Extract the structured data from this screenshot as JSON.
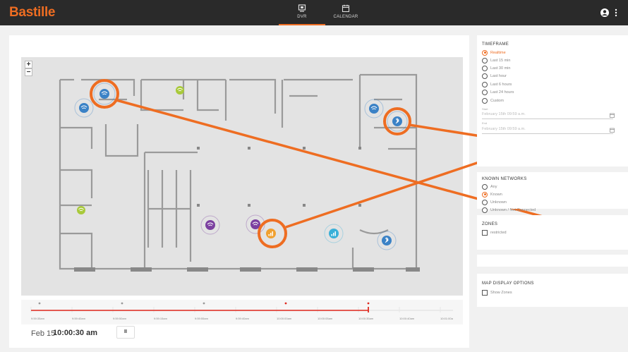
{
  "header": {
    "brand": "Bastille",
    "tabs": [
      {
        "label": "DVR",
        "icon": "dvr-icon",
        "active": true
      },
      {
        "label": "CALENDAR",
        "icon": "calendar-icon",
        "active": false
      }
    ],
    "user_icon": "user-icon",
    "menu_icon": "more-vertical-icon"
  },
  "map": {
    "zoom_in": "+",
    "zoom_out": "−",
    "devices": [
      {
        "type": "wifi",
        "color": "#3b82c6",
        "highlighted": true
      },
      {
        "type": "wifi",
        "color": "#3b82c6",
        "highlighted": false
      },
      {
        "type": "wifi",
        "color": "#a8c93a",
        "highlighted": false
      },
      {
        "type": "wifi",
        "color": "#3b82c6",
        "highlighted": false
      },
      {
        "type": "bluetooth",
        "color": "#3b82c6",
        "highlighted": true
      },
      {
        "type": "wifi",
        "color": "#a8c93a",
        "highlighted": false
      },
      {
        "type": "wifi",
        "color": "#7b3fa0",
        "highlighted": false
      },
      {
        "type": "wifi",
        "color": "#7b3fa0",
        "highlighted": false
      },
      {
        "type": "cellular",
        "color": "#f0a030",
        "highlighted": true
      },
      {
        "type": "cellular",
        "color": "#3ab0d8",
        "highlighted": false
      },
      {
        "type": "bluetooth",
        "color": "#3b82c6",
        "highlighted": false
      }
    ]
  },
  "timeline": {
    "ticks": [
      "9:59:35am",
      "9:59:40am",
      "9:59:50am",
      "9:59:15am",
      "9:59:55am",
      "9:59:40am",
      "10:00:00am",
      "10:00:05am",
      "10:00:35am",
      "10:00:40am",
      "10:01:00a"
    ],
    "progress": 0.86,
    "date": "Feb 15",
    "time": "10:00:30 am",
    "pause_label": "II"
  },
  "timeframe": {
    "title": "TIMEFRAME",
    "options": [
      "Realtime",
      "Last 15 min",
      "Last 30 min",
      "Last hour",
      "Last 6 hours",
      "Last 24 hours",
      "Custom"
    ],
    "selected": "Realtime",
    "start_caption": "Start",
    "start_value": "February 15th 09:59 a.m.",
    "end_caption": "End",
    "end_value": "February 15th 09:59 a.m."
  },
  "known_networks": {
    "title": "KNOWN NETWORKS",
    "options": [
      "Any",
      "Known",
      "Unknown",
      "Unknown / Not Connected"
    ],
    "selected": "Known"
  },
  "zones": {
    "title": "ZONES",
    "items": [
      "restricted"
    ]
  },
  "map_display": {
    "title": "MAP DISPLAY OPTIONS",
    "items": [
      "Show Zones"
    ]
  },
  "colors": {
    "accent": "#ee6d22",
    "topbar": "#2a2a2a",
    "timeline_red": "#e0291f"
  }
}
